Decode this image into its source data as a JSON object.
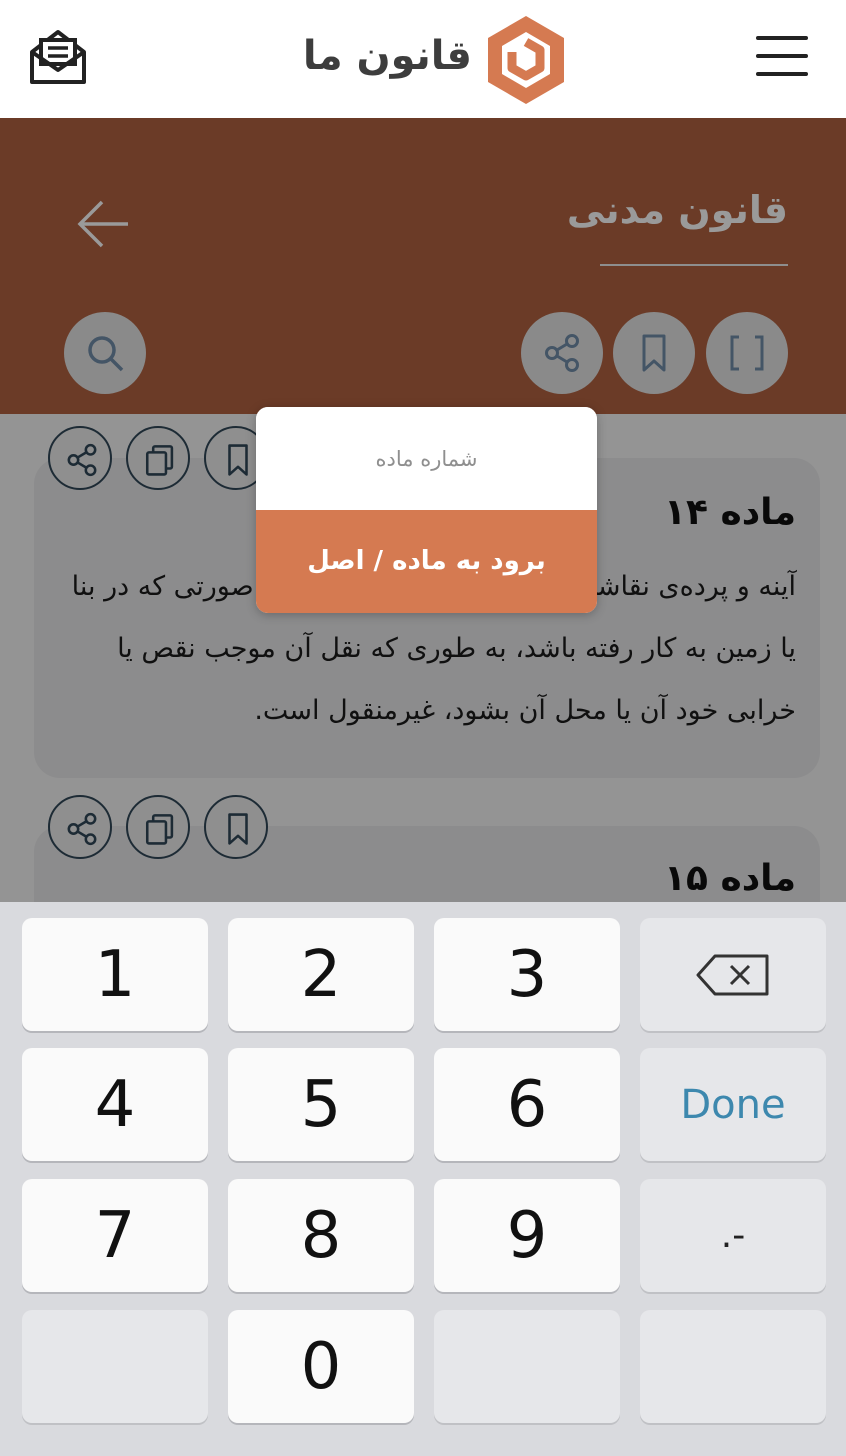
{
  "app": {
    "logo_text": "قانون ما",
    "colors": {
      "brand_orange": "#d57a51",
      "header_brown": "#6b3b27"
    }
  },
  "header": {
    "title": "قانون مدنی"
  },
  "articles": [
    {
      "title": "ماده ۱۴",
      "body": "آینه و پرده‌ی نقاشی و مجسمه و امثال آن نیز در صورتی که در بنا یا زمین به کار رفته باشد، به طوری که نقل آن موجب نقص یا خرابی خود آن یا محل آن بشود، غیرمنقول است."
    },
    {
      "title": "ماده ۱۵",
      "body": ""
    }
  ],
  "dialog": {
    "placeholder": "شماره ماده",
    "go_label": "برود به ماده / اصل"
  },
  "keypad": {
    "keys": [
      "1",
      "2",
      "3",
      "4",
      "5",
      "6",
      "7",
      "8",
      "9",
      "0"
    ],
    "done_label": "Done",
    "symbols_label": ".-"
  }
}
